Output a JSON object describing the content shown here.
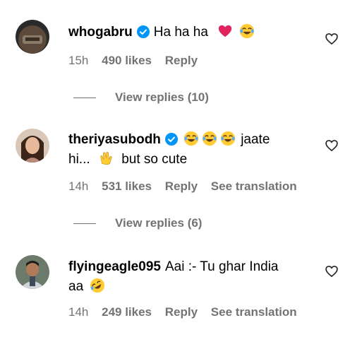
{
  "comments": [
    {
      "username": "whogabru",
      "text_before": "Ha ha ha",
      "text_line2": "",
      "time": "15h",
      "likes": "490 likes",
      "reply": "Reply",
      "translation": "",
      "icons": [
        "verified-badge",
        "red-heart-emoji",
        "tears-of-joy-emoji"
      ]
    },
    {
      "username": "theriyasubodh",
      "text_after_emojis": "jaate",
      "text_line2_a": "hi...",
      "text_line2_b": "but so cute",
      "time": "14h",
      "likes": "531 likes",
      "reply": "Reply",
      "translation": "See translation"
    },
    {
      "username": "flyingeagle095",
      "text_line1": "Aai :- Tu ghar India",
      "text_line2": "aa",
      "time": "14h",
      "likes": "249 likes",
      "reply": "Reply",
      "translation": "See translation"
    }
  ],
  "view_replies": [
    {
      "label": "View replies (10)"
    },
    {
      "label": "View replies (6)"
    }
  ],
  "colors": {
    "secondary_text": "#737373",
    "verified_blue": "#0095f6",
    "heart_red": "#e0245e",
    "emoji_yellow": "#ffcc33"
  }
}
